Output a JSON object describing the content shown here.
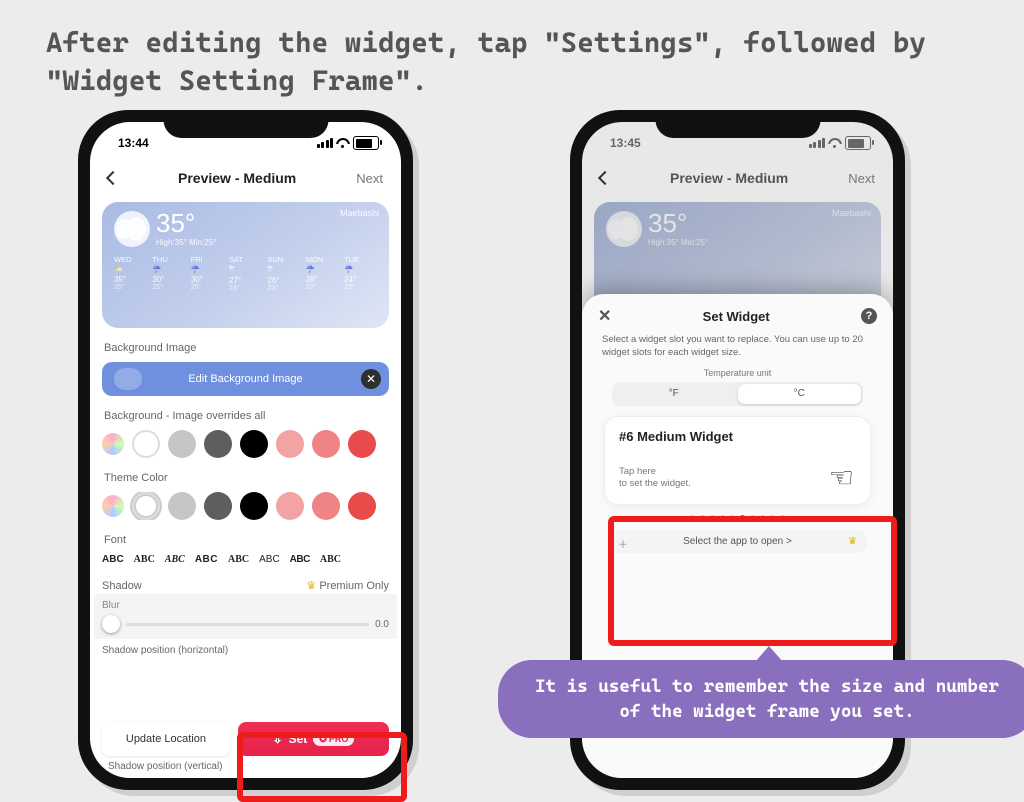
{
  "instruction": "After editing the widget, tap \"Settings\", followed by \"Widget Setting Frame\".",
  "callout": "It is useful to remember the size and number of the widget frame you set.",
  "status": {
    "time_left": "13:44",
    "time_right": "13:45"
  },
  "nav": {
    "title": "Preview - Medium",
    "next": "Next"
  },
  "weather": {
    "city": "Maebashi",
    "temp": "35°",
    "hilo": "High:35° Min:25°",
    "days": [
      {
        "d": "WED",
        "t": "35°",
        "r": "25°"
      },
      {
        "d": "THU",
        "t": "30°",
        "r": "25°"
      },
      {
        "d": "FRI",
        "t": "30°",
        "r": "25°"
      },
      {
        "d": "SAT",
        "t": "27°",
        "r": "23°"
      },
      {
        "d": "SUN",
        "t": "26°",
        "r": "23°"
      },
      {
        "d": "MON",
        "t": "28°",
        "r": "23°"
      },
      {
        "d": "TUE",
        "t": "24°",
        "r": "22°"
      }
    ]
  },
  "labels": {
    "bg_image": "Background Image",
    "edit_bg": "Edit Background Image",
    "bg_override": "Background - Image overrides all",
    "theme": "Theme Color",
    "font": "Font",
    "shadow": "Shadow",
    "premium": "Premium Only",
    "blur": "Blur",
    "zero": "0.0",
    "sp_horiz": "Shadow position (horizontal)",
    "sp_vert": "Shadow position (vertical)",
    "update": "Update Location",
    "set": "Set",
    "pro": "PRO"
  },
  "fonts": [
    "ABC",
    "ABC",
    "ABC",
    "ABC",
    "ABC",
    "ABC",
    "ABC",
    "ABC"
  ],
  "swatches_bg": [
    "#ffffff",
    "#c6c6c6",
    "#5e5e5e",
    "#000000",
    "#f2a4a4",
    "#f08484",
    "#e94a4a"
  ],
  "swatches_theme": [
    "#ffffff",
    "#c6c6c6",
    "#5e5e5e",
    "#000000",
    "#f2a4a4",
    "#f08484",
    "#e94a4a"
  ],
  "sheet": {
    "title": "Set Widget",
    "help": "Select a widget slot you want to replace. You can use up to 20 widget slots for each widget size.",
    "tunit_label": "Temperature unit",
    "unit_f": "°F",
    "unit_c": "°C",
    "slot_title": "#6 Medium Widget",
    "tap1": "Tap here",
    "tap2": "to set the widget.",
    "openapp": "Select the app to open >"
  }
}
